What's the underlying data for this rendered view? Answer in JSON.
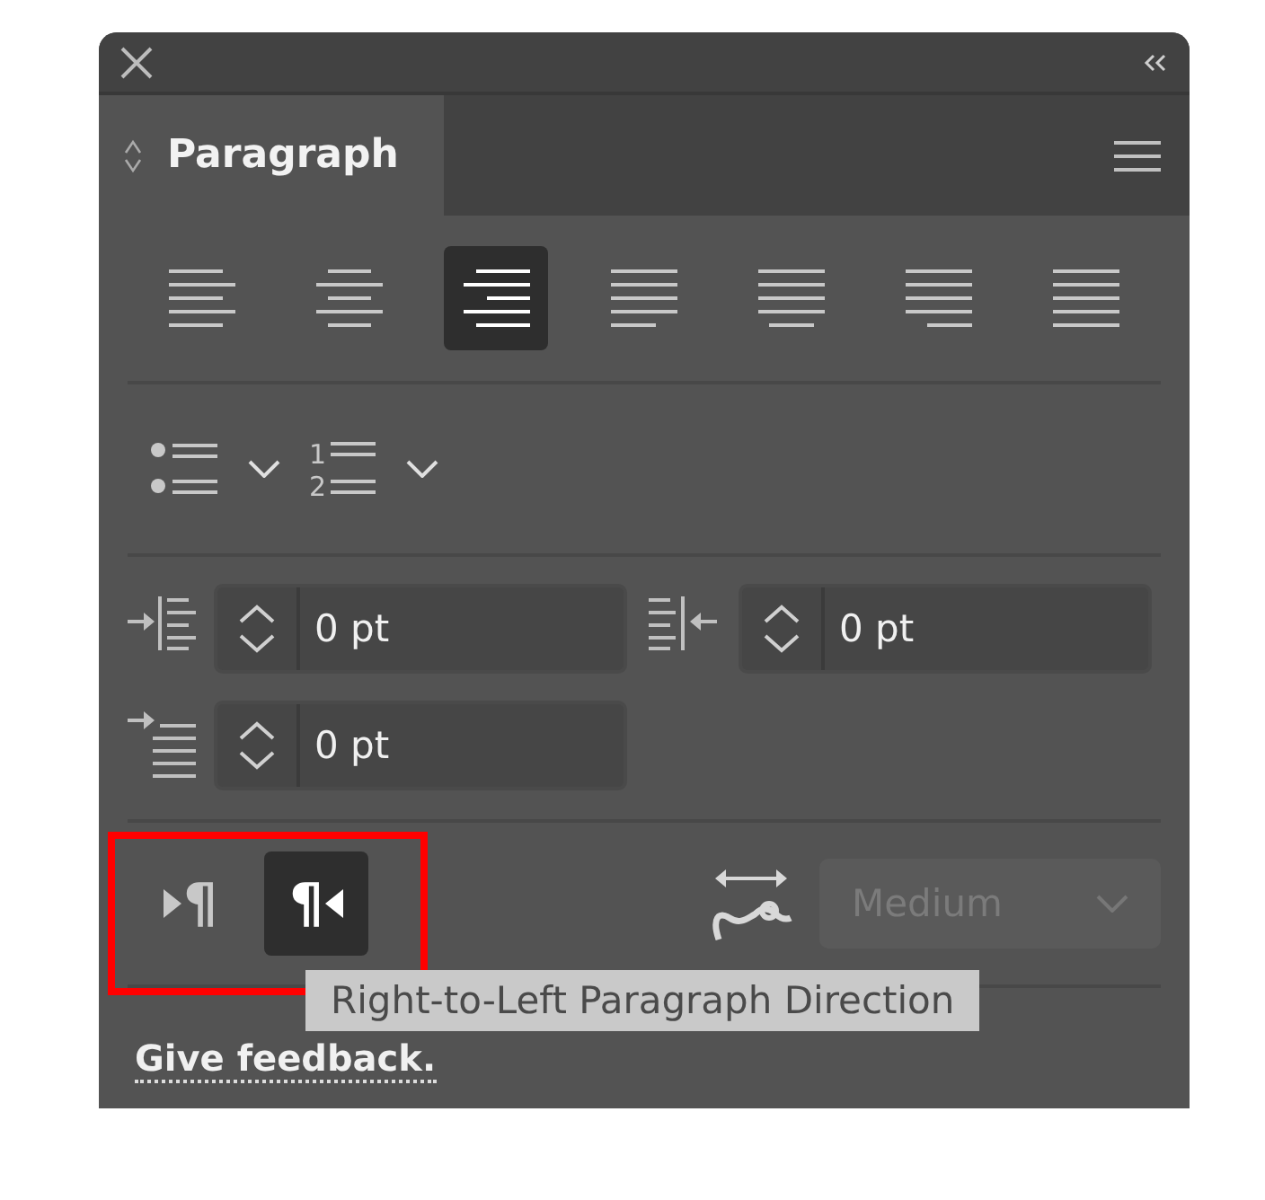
{
  "window": {
    "tab": {
      "label": "Paragraph",
      "selected": true
    }
  },
  "alignment_buttons": [
    {
      "kind": "left",
      "selected": false
    },
    {
      "kind": "center",
      "selected": false
    },
    {
      "kind": "right",
      "selected": true
    },
    {
      "kind": "justify_left",
      "selected": false
    },
    {
      "kind": "justify_center",
      "selected": false
    },
    {
      "kind": "justify_right",
      "selected": false
    },
    {
      "kind": "justify_all",
      "selected": false
    }
  ],
  "lists": {
    "numbered_markers": [
      "1",
      "2"
    ]
  },
  "indents": [
    {
      "kind": "left",
      "value": "0 pt"
    },
    {
      "kind": "right",
      "value": "0 pt"
    },
    {
      "kind": "first_line",
      "value": "0 pt"
    }
  ],
  "direction_buttons": [
    {
      "kind": "ltr",
      "glyph": "¶",
      "selected": false
    },
    {
      "kind": "rtl",
      "glyph": "¶",
      "selected": true
    }
  ],
  "kashida": {
    "value": "Medium",
    "disabled": true
  },
  "tooltip": "Right-to-Left Paragraph Direction",
  "feedback_link": "Give feedback."
}
